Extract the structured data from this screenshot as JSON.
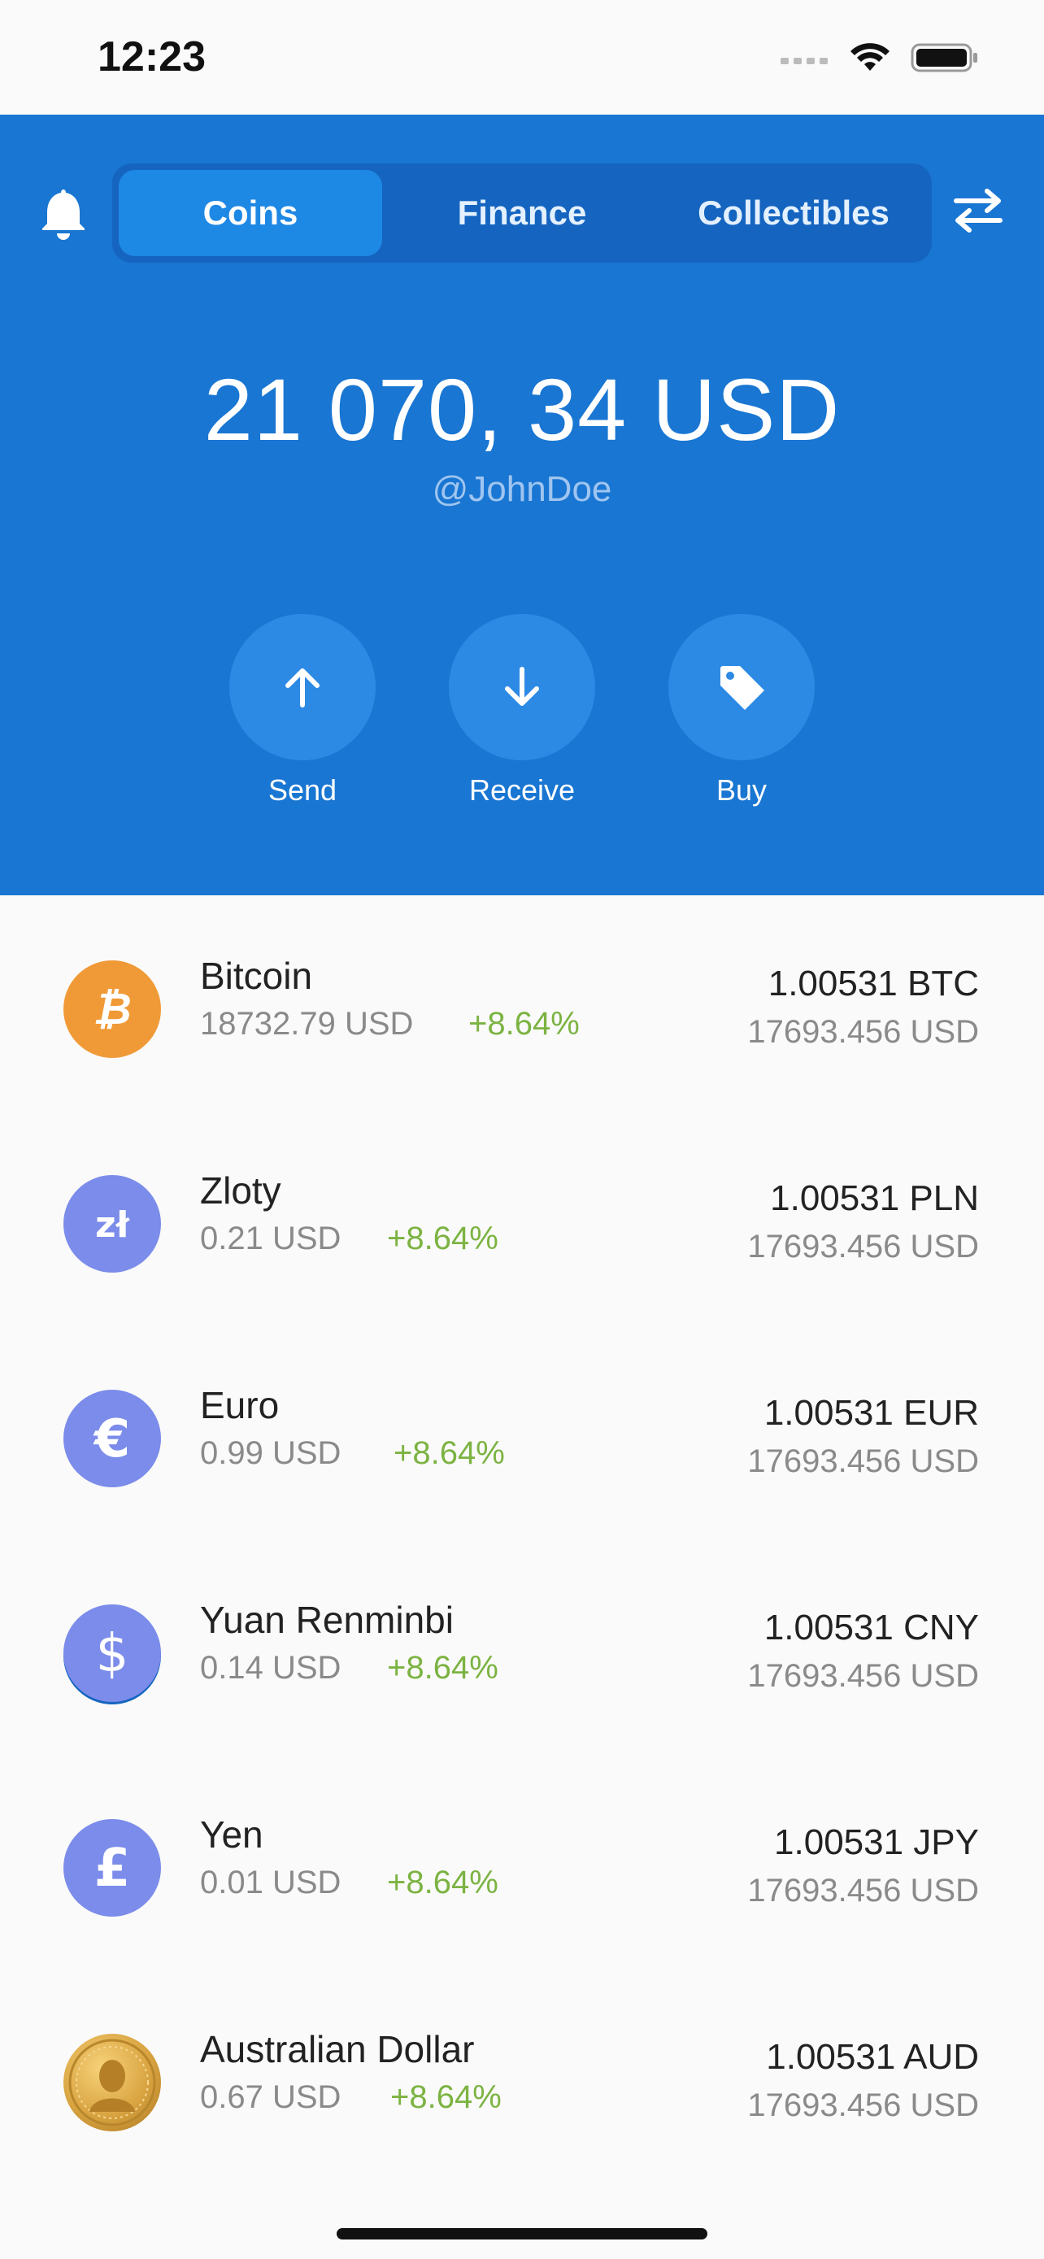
{
  "status_bar": {
    "time": "12:23"
  },
  "header": {
    "tabs": [
      {
        "label": "Coins",
        "active": true
      },
      {
        "label": "Finance",
        "active": false
      },
      {
        "label": "Collectibles",
        "active": false
      }
    ],
    "balance": "21 070, 34 USD",
    "username": "@JohnDoe",
    "actions": [
      {
        "label": "Send",
        "icon": "arrow-up-icon"
      },
      {
        "label": "Receive",
        "icon": "arrow-down-icon"
      },
      {
        "label": "Buy",
        "icon": "tag-icon"
      }
    ],
    "bell_icon": "bell-icon",
    "switch_icon": "swap-arrows-icon"
  },
  "coins": [
    {
      "name": "Bitcoin",
      "price": "18732.79 USD",
      "change": "+8.64%",
      "amount": "1.00531 BTC",
      "value": "17693.456 USD",
      "icon": "bitcoin-icon",
      "color": "#f09a37"
    },
    {
      "name": "Zloty",
      "price": "0.21 USD",
      "change": "+8.64%",
      "amount": "1.00531 PLN",
      "value": "17693.456 USD",
      "icon": "zloty-icon",
      "color": "#7b8cea"
    },
    {
      "name": "Euro",
      "price": "0.99 USD",
      "change": "+8.64%",
      "amount": "1.00531 EUR",
      "value": "17693.456 USD",
      "icon": "euro-icon",
      "color": "#7b8cea"
    },
    {
      "name": "Yuan Renminbi",
      "price": "0.14 USD",
      "change": "+8.64%",
      "amount": "1.00531 CNY",
      "value": "17693.456 USD",
      "icon": "yuan-icon",
      "color": "#7b8cea"
    },
    {
      "name": "Yen",
      "price": "0.01 USD",
      "change": "+8.64%",
      "amount": "1.00531 JPY",
      "value": "17693.456 USD",
      "icon": "pound-icon",
      "color": "#7b8cea"
    },
    {
      "name": "Australian Dollar",
      "price": "0.67 USD",
      "change": "+8.64%",
      "amount": "1.00531 AUD",
      "value": "17693.456 USD",
      "icon": "gold-coin-icon",
      "color": "#d9a441"
    }
  ]
}
